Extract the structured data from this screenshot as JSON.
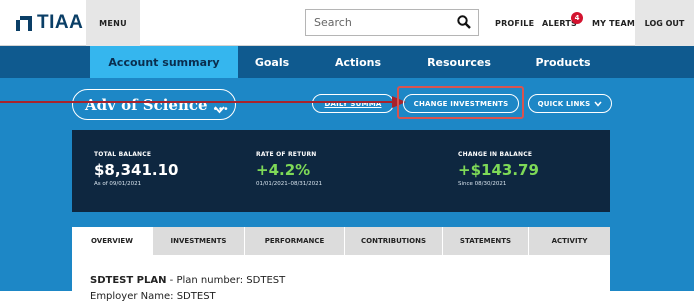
{
  "header": {
    "logo_text": "TIAA",
    "menu_label": "MENU",
    "search_placeholder": "Search",
    "profile_label": "PROFILE",
    "alerts_label": "ALERTS",
    "alerts_count": "4",
    "my_team_label": "MY TEAM",
    "log_out_label": "LOG OUT"
  },
  "nav": {
    "tabs": [
      {
        "label": "Account summary",
        "active": true
      },
      {
        "label": "Goals"
      },
      {
        "label": "Actions"
      },
      {
        "label": "Resources"
      },
      {
        "label": "Products"
      }
    ]
  },
  "plan_selector": {
    "value": "Adv of Science ..."
  },
  "actions": {
    "daily_summary_label": "DAILY SUMMA",
    "change_investments_label": "CHANGE INVESTMENTS",
    "quick_links_label": "QUICK LINKS"
  },
  "balances": {
    "total_balance": {
      "label": "TOTAL BALANCE",
      "value": "$8,341.10",
      "sub": "As of 09/01/2021"
    },
    "rate_of_return": {
      "label": "RATE OF RETURN",
      "value": "+4.2%",
      "sub": "01/01/2021–08/31/2021"
    },
    "change_in_balance": {
      "label": "CHANGE IN BALANCE",
      "value": "+$143.79",
      "sub": "Since 08/30/2021"
    }
  },
  "account_tabs": [
    {
      "label": "OVERVIEW",
      "active": true
    },
    {
      "label": "INVESTMENTS"
    },
    {
      "label": "PERFORMANCE"
    },
    {
      "label": "CONTRIBUTIONS"
    },
    {
      "label": "STATEMENTS"
    },
    {
      "label": "ACTIVITY"
    }
  ],
  "plan_info": {
    "plan_name": "SDTEST PLAN",
    "plan_number_text": " - Plan number: SDTEST",
    "employer_text": "Employer Name: SDTEST"
  },
  "colors": {
    "brand_navy": "#0a3e66",
    "nav_bar": "#0f5a8f",
    "active_tab": "#35b6ee",
    "background_blue": "#1d87c6",
    "panel_dark": "#0e2740",
    "positive_green": "#7ed957",
    "highlight_red": "#d9534f",
    "alert_badge": "#d3132f"
  }
}
